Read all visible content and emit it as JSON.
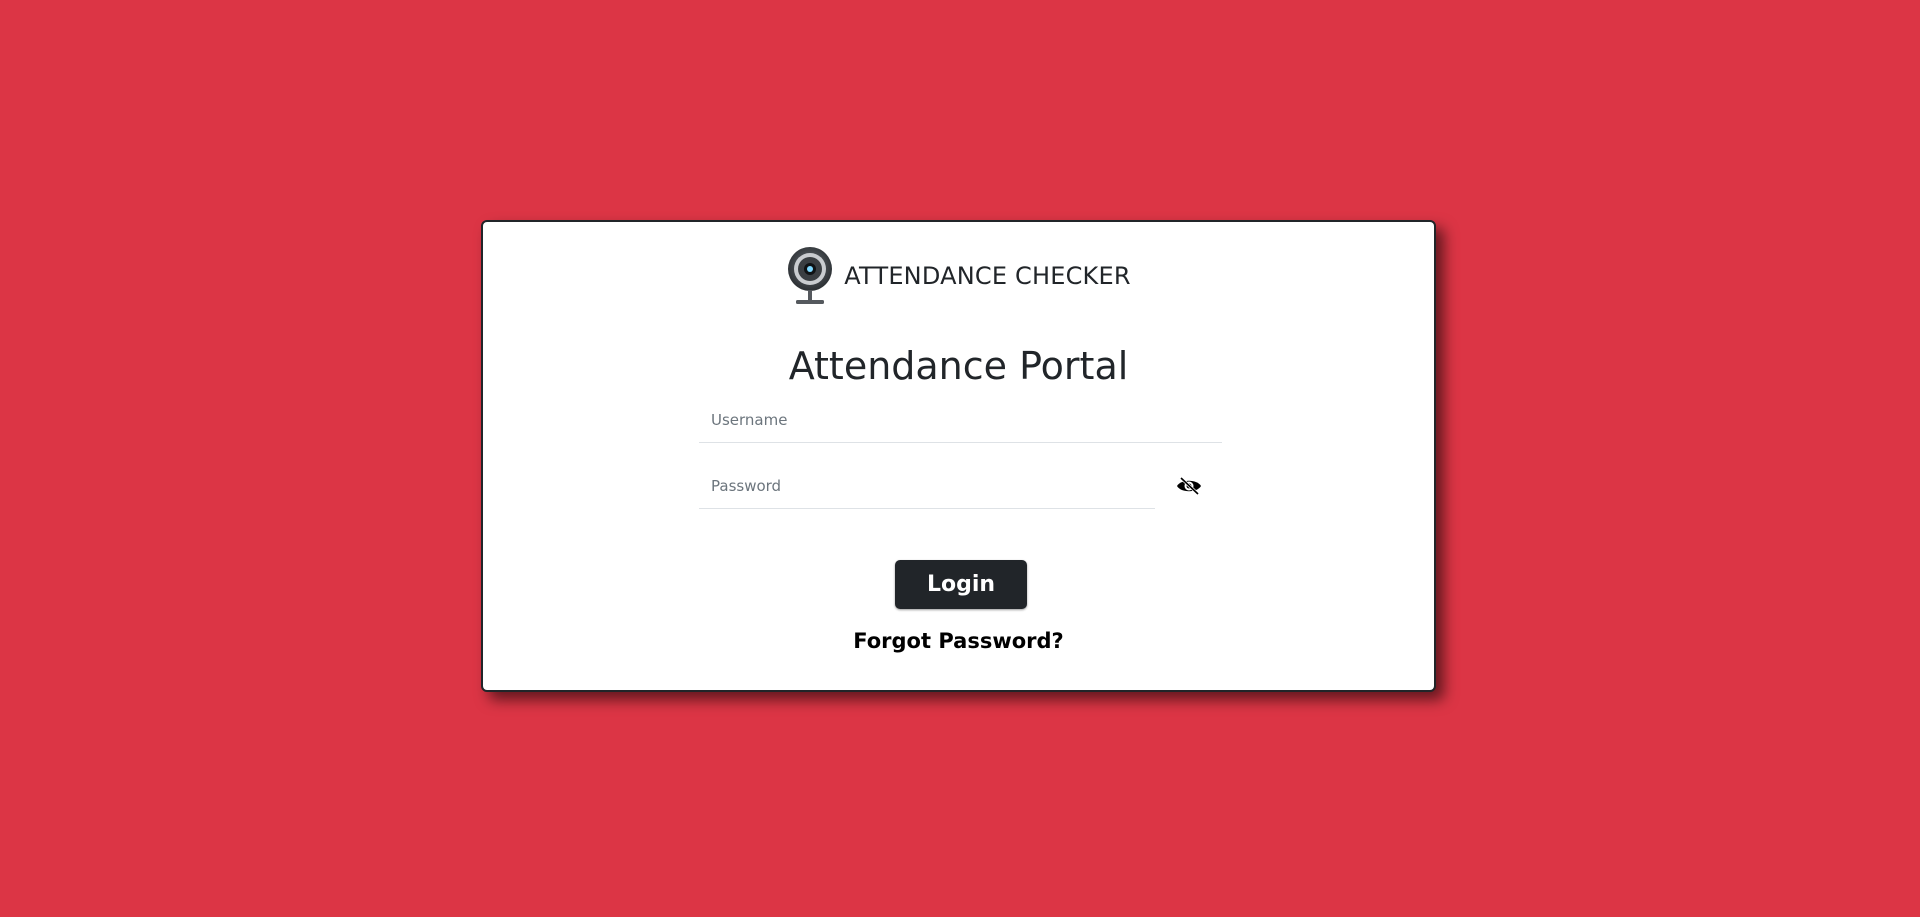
{
  "colors": {
    "background": "#dc3545",
    "card": "#ffffff",
    "button": "#212529",
    "text": "#212529"
  },
  "brand": {
    "logo_icon": "webcam-icon",
    "name": "ATTENDANCE CHECKER"
  },
  "page_title": "Attendance Portal",
  "form": {
    "username": {
      "placeholder": "Username",
      "value": ""
    },
    "password": {
      "placeholder": "Password",
      "value": "",
      "toggle_icon": "eye-slash-icon"
    },
    "login_label": "Login",
    "forgot_label": "Forgot Password?"
  }
}
